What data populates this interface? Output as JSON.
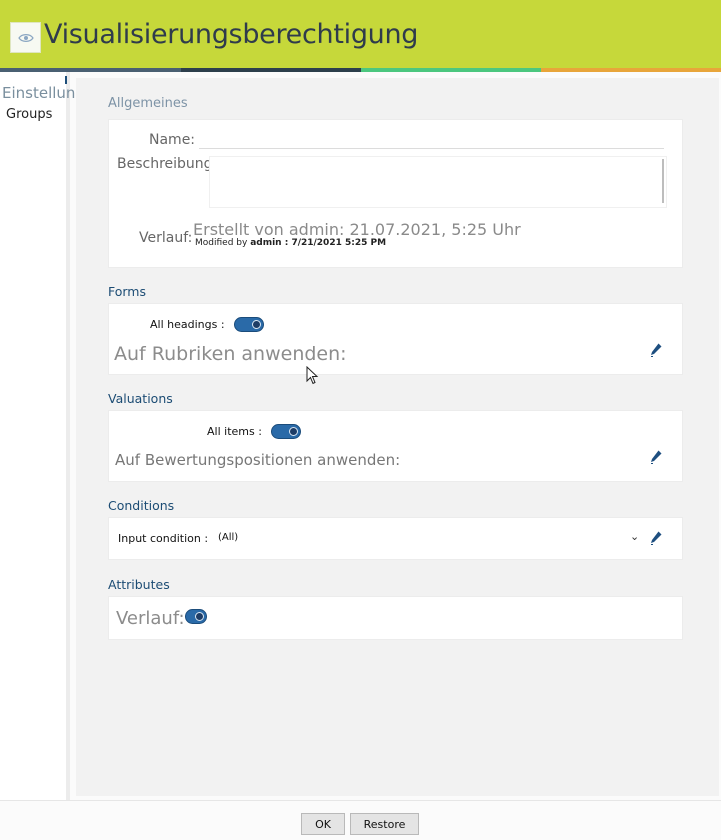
{
  "header": {
    "title": "Visualisierungsberechtigung",
    "icon": "eye-icon",
    "stripe_colors": [
      "#4a6072",
      "#2d3f4c",
      "#4cc77f",
      "#e8a53a"
    ],
    "accent": "#c6d83a"
  },
  "sidebar": {
    "heading": "Einstellungen",
    "items": [
      {
        "label": "Groups"
      }
    ]
  },
  "general": {
    "section_title": "Allgemeines",
    "name_label": "Name:",
    "name_value": "",
    "description_label": "Beschreibung:",
    "description_value": "",
    "history_label": "Verlauf:",
    "history_created": "Erstellt von admin: 21.07.2021, 5:25 Uhr",
    "history_modified_prefix": "Modified by",
    "history_modified_detail": "admin : 7/21/2021 5:25 PM"
  },
  "forms": {
    "section_title": "Forms",
    "toggle_label": "All headings :",
    "toggle_on": true,
    "apply_label": "Auf Rubriken anwenden:"
  },
  "valuations": {
    "section_title": "Valuations",
    "toggle_label": "All items :",
    "toggle_on": true,
    "apply_label": "Auf Bewertungspositionen anwenden:"
  },
  "conditions": {
    "section_title": "Conditions",
    "input_label": "Input condition :",
    "selected_value": "(All)"
  },
  "attributes": {
    "section_title": "Attributes",
    "history_label": "Verlauf:",
    "toggle_on": true
  },
  "footer": {
    "ok_label": "OK",
    "restore_label": "Restore"
  }
}
